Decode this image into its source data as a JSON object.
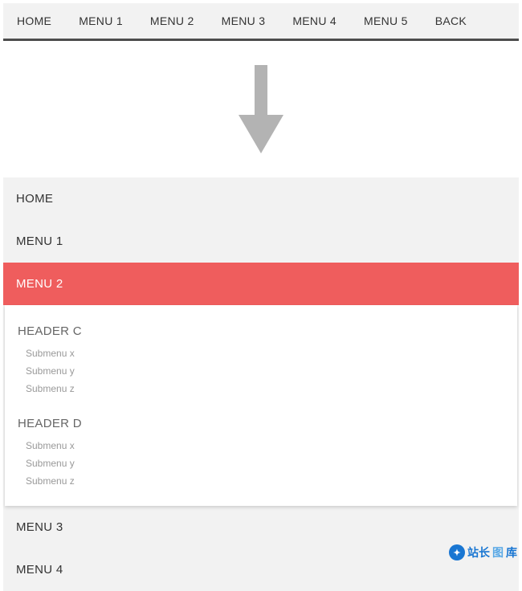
{
  "topNav": {
    "items": [
      "HOME",
      "MENU 1",
      "MENU 2",
      "MENU 3",
      "MENU 4",
      "MENU 5",
      "BACK"
    ]
  },
  "verticalMenu": {
    "items": [
      "HOME",
      "MENU 1",
      "MENU 2",
      "MENU 3",
      "MENU 4"
    ],
    "activeIndex": 2,
    "expanded": {
      "groups": [
        {
          "header": "HEADER C",
          "links": [
            "Submenu x",
            "Submenu y",
            "Submenu z"
          ]
        },
        {
          "header": "HEADER D",
          "links": [
            "Submenu x",
            "Submenu y",
            "Submenu z"
          ]
        }
      ]
    }
  },
  "watermark": {
    "part1": "站长",
    "part2": "图",
    "part3": "库"
  },
  "colors": {
    "active": "#ef5d5d",
    "navBg": "#f2f2f2",
    "border": "#4d4d4d"
  }
}
